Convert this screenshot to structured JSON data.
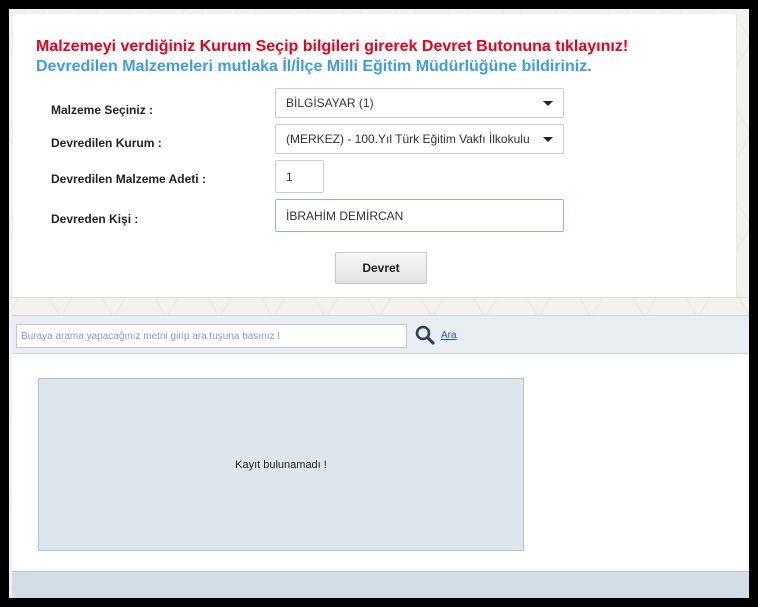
{
  "form": {
    "title_warning": "Malzemeyi verdiğiniz Kurum Seçip bilgileri girerek Devret Butonuna tıklayınız!",
    "title_info": "Devredilen Malzemeleri mutlaka İl/İlçe Milli Eğitim Müdürlüğüne bildiriniz.",
    "malzeme_label": "Malzeme Seçiniz :",
    "malzeme_value": "BİLGİSAYAR (1)",
    "kurum_label": "Devredilen Kurum :",
    "kurum_value": "(MERKEZ) - 100.Yıl Türk Eğitim Vakfı İlkokulu",
    "adet_label": "Devredilen Malzeme Adeti :",
    "adet_value": "1",
    "kisi_label": "Devreden Kişi :",
    "kisi_value": "İBRAHİM DEMİRCAN",
    "devret_button": "Devret"
  },
  "search": {
    "placeholder": "Buraya arama yapacağınız metni girip ara tuşuna basınız !",
    "search_link": "Ara",
    "search_icon": "magnifier-icon"
  },
  "results": {
    "empty_message": "Kayıt bulunamadı !"
  },
  "colors": {
    "warning": "#e8001d",
    "info": "#3d9be9"
  }
}
